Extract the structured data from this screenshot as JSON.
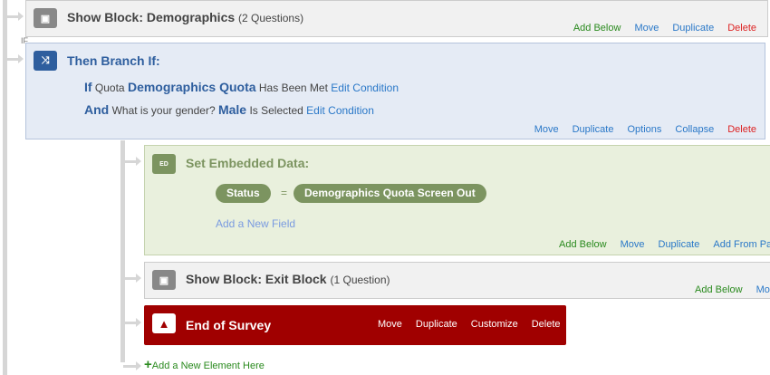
{
  "block1": {
    "title": "Show Block: Demographics",
    "count": "(2 Questions)",
    "actions": [
      "Add Below",
      "Move",
      "Duplicate",
      "Delete"
    ]
  },
  "branch": {
    "title": "Then Branch If:",
    "tiny_label": "IF",
    "line1": {
      "kw": "If",
      "pre": "Quota",
      "name": "Demographics Quota",
      "post": "Has Been Met",
      "link": "Edit Condition"
    },
    "line2": {
      "kw": "And",
      "pre": "What is your gender?",
      "name": "Male",
      "post": "Is Selected",
      "link": "Edit Condition"
    },
    "actions": [
      "Move",
      "Duplicate",
      "Options",
      "Collapse",
      "Delete"
    ]
  },
  "embedded": {
    "icon_label": "ED",
    "title": "Set Embedded Data:",
    "field": "Status",
    "eq": "=",
    "value": "Demographics Quota Screen Out",
    "add_field": "Add a New Field",
    "actions": [
      "Add Below",
      "Move",
      "Duplicate",
      "Add From Pa"
    ]
  },
  "block2": {
    "title": "Show Block: Exit Block",
    "count": "(1 Question)",
    "actions": [
      "Add Below",
      "Mo"
    ]
  },
  "end": {
    "title": "End of Survey",
    "actions": [
      "Move",
      "Duplicate",
      "Customize",
      "Delete"
    ]
  },
  "add_element": "Add a New Element Here"
}
